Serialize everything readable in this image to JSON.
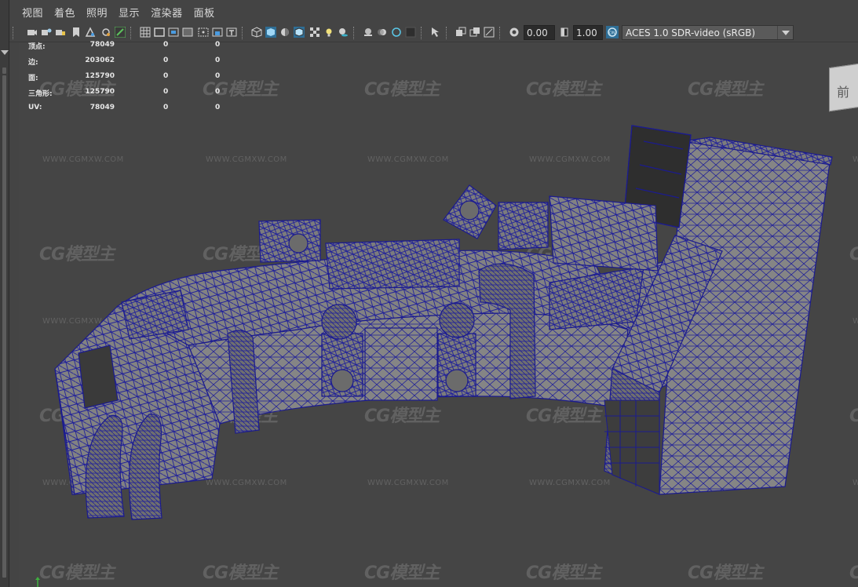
{
  "menubar": {
    "items": [
      "视图",
      "着色",
      "照明",
      "显示",
      "渲染器",
      "面板"
    ]
  },
  "toolbar": {
    "exposure_value": "0.00",
    "gamma_value": "1.00",
    "color_space": "ACES 1.0 SDR-video (sRGB)",
    "icons": [
      "camera-select-icon",
      "camera-attributes-icon",
      "bookmark-icon",
      "image-plane-icon",
      "2d-pan-icon",
      "grease-pencil-icon",
      "grid-icon",
      "film-gate-icon",
      "resolution-gate-icon",
      "gate-mask-icon",
      "field-chart-icon",
      "safe-action-icon",
      "safe-title-icon",
      "wireframe-icon",
      "smooth-shade-icon",
      "default-material-icon",
      "wireframe-on-shaded-icon",
      "textured-icon",
      "use-all-lights-icon",
      "shadows-icon",
      "screen-space-ao-icon",
      "motion-blur-icon",
      "multisample-aa-icon",
      "depth-of-field-icon",
      "isolate-select-icon",
      "xray-icon",
      "xray-active-components-icon",
      "xray-joints-icon",
      "exposure-icon",
      "gamma-icon",
      "color-management-icon"
    ]
  },
  "hud": {
    "rows": [
      {
        "label": "顶点:",
        "v1": "78049",
        "v2": "0",
        "v3": "0"
      },
      {
        "label": "边:",
        "v1": "203062",
        "v2": "0",
        "v3": "0"
      },
      {
        "label": "面:",
        "v1": "125790",
        "v2": "0",
        "v3": "0"
      },
      {
        "label": "三角形:",
        "v1": "125790",
        "v2": "0",
        "v3": "0"
      },
      {
        "label": "UV:",
        "v1": "78049",
        "v2": "0",
        "v3": "0"
      }
    ]
  },
  "viewcube": {
    "label": "前"
  },
  "watermark": {
    "logo": "CG模型主",
    "url": "WWW.CGMXW.COM"
  },
  "colors": {
    "background": "#454545",
    "wire": "#1f1f9a",
    "surface": "#7e7e7e",
    "ui_dark": "#2b2b2b",
    "active_icon": "#5cc25c",
    "axis_green": "#3fb03f"
  }
}
